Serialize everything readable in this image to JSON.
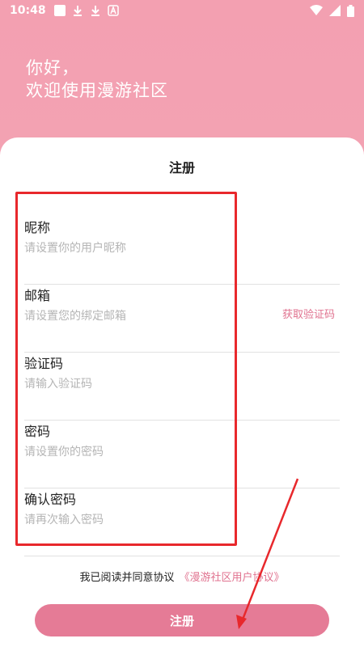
{
  "status_bar": {
    "time": "10:48",
    "left_icons": [
      "notification-square-icon",
      "download-icon",
      "download-icon",
      "app-a-icon"
    ],
    "right_icons": [
      "wifi-icon",
      "signal-icon",
      "battery-icon"
    ]
  },
  "greeting": {
    "line1": "你好，",
    "line2": "欢迎使用漫游社区"
  },
  "form": {
    "title": "注册",
    "fields": [
      {
        "label": "昵称",
        "placeholder": "请设置你的用户昵称",
        "value": ""
      },
      {
        "label": "邮箱",
        "placeholder": "请设置您的绑定邮箱",
        "value": "",
        "action": "获取验证码"
      },
      {
        "label": "验证码",
        "placeholder": "请输入验证码",
        "value": ""
      },
      {
        "label": "密码",
        "placeholder": "请设置你的密码",
        "value": ""
      },
      {
        "label": "确认密码",
        "placeholder": "请再次输入密码",
        "value": ""
      }
    ],
    "agreement_text": "我已阅读并同意协议",
    "agreement_link": "《漫游社区用户协议》",
    "submit_label": "注册"
  },
  "colors": {
    "header_bg": "#f3a0b1",
    "accent": "#e0728f",
    "button_bg": "#e57b96",
    "annotation": "#e8282c"
  }
}
